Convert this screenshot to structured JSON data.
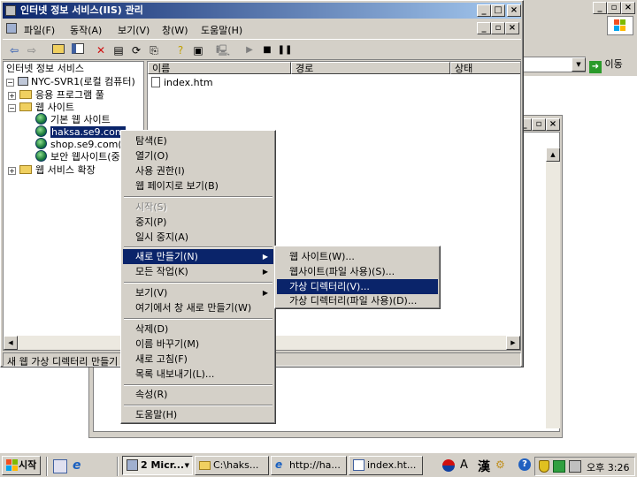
{
  "window": {
    "title": "인터넷 정보 서비스(IIS) 관리",
    "menu": [
      "파일(F)",
      "동작(A)",
      "보기(V)",
      "창(W)",
      "도움말(H)"
    ]
  },
  "tree": {
    "header": "인터넷 정보 서비스",
    "items": [
      {
        "label": "NYC-SVR1(로컬 컴퓨터)",
        "icon": "computer-icon"
      },
      {
        "label": "응용 프로그램 풀",
        "icon": "folder-icon"
      },
      {
        "label": "웹 사이트",
        "icon": "folder-icon"
      },
      {
        "label": "기본 웹 사이트",
        "icon": "globe-icon"
      },
      {
        "label": "haksa.se9.com",
        "icon": "globe-icon"
      },
      {
        "label": "shop.se9.com(중",
        "icon": "globe-icon"
      },
      {
        "label": "보안 웹사이트(중",
        "icon": "globe-icon"
      },
      {
        "label": "웹 서비스 확장",
        "icon": "folder-icon"
      }
    ]
  },
  "list": {
    "columns": [
      "이름",
      "경로",
      "상태"
    ],
    "rows": [
      {
        "name": "index.htm"
      }
    ]
  },
  "status_text": "새 웹 가상 디렉터리 만들기",
  "context_menu": {
    "items": [
      "탐색(E)",
      "열기(O)",
      "사용 권한(I)",
      "웹 페이지로 보기(B)",
      "시작(S)",
      "중지(P)",
      "일시 중지(A)",
      "새로 만들기(N)",
      "모든 작업(K)",
      "보기(V)",
      "여기에서 창 새로 만들기(W)",
      "삭제(D)",
      "이름 바꾸기(M)",
      "새로 고침(F)",
      "목록 내보내기(L)...",
      "속성(R)",
      "도움말(H)"
    ]
  },
  "submenu": {
    "items": [
      "웹 사이트(W)...",
      "웹사이트(파일 사용)(S)...",
      "가상 디렉터리(V)...",
      "가상 디렉터리(파일 사용)(D)..."
    ]
  },
  "bg_window": {
    "goto_label": "이동"
  },
  "taskbar": {
    "start": "시작",
    "buttons": [
      "2 Micr...",
      "C:\\haks...",
      "http://ha...",
      "index.ht..."
    ],
    "ime": [
      "A",
      "漢"
    ],
    "clock": "오후 3:26"
  },
  "colors": {
    "highlight": "#0a246a",
    "face": "#d4d0c8"
  }
}
